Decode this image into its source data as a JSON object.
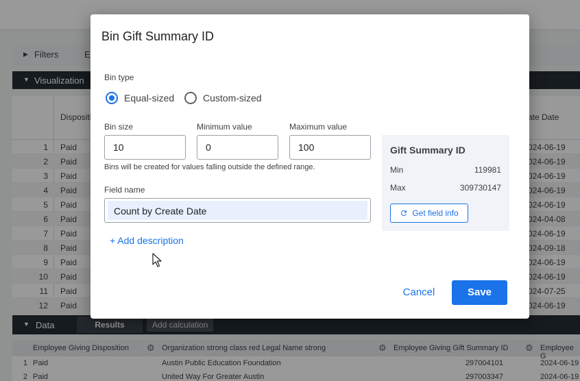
{
  "background": {
    "filters_label": "Filters",
    "filters_extra": "E",
    "visualization_label": "Visualization",
    "viz_header": {
      "disposition": "Dispositi",
      "date": "ate Date"
    },
    "viz_rows": [
      {
        "n": "1",
        "d": "Paid",
        "dt": "024-06-19"
      },
      {
        "n": "2",
        "d": "Paid",
        "dt": "024-06-19"
      },
      {
        "n": "3",
        "d": "Paid",
        "dt": "024-06-19"
      },
      {
        "n": "4",
        "d": "Paid",
        "dt": "024-06-19"
      },
      {
        "n": "5",
        "d": "Paid",
        "dt": "024-06-19"
      },
      {
        "n": "6",
        "d": "Paid",
        "dt": "024-04-08"
      },
      {
        "n": "7",
        "d": "Paid",
        "dt": "024-06-19"
      },
      {
        "n": "8",
        "d": "Paid",
        "dt": "024-09-18"
      },
      {
        "n": "9",
        "d": "Paid",
        "dt": "024-06-19"
      },
      {
        "n": "10",
        "d": "Paid",
        "dt": "024-06-19"
      },
      {
        "n": "11",
        "d": "Paid",
        "dt": "024-07-25"
      },
      {
        "n": "12",
        "d": "Paid",
        "dt": "024-06-19"
      }
    ],
    "data_label": "Data",
    "results_tab": "Results",
    "add_calculation": "Add calculation",
    "data_headers": {
      "col1": "Employee Giving Disposition",
      "col2": "Organization strong class red Legal Name strong",
      "col3": "Employee Giving Gift Summary ID",
      "col4": "Employee G"
    },
    "data_rows": [
      {
        "n": "1",
        "disp": "Paid",
        "org": "Austin Public Education Foundation",
        "id": "297004101",
        "date": "2024-06-19"
      },
      {
        "n": "2",
        "disp": "Paid",
        "org": "United Way For Greater Austin",
        "id": "297003347",
        "date": "2024-06-19"
      }
    ]
  },
  "dialog": {
    "title": "Bin Gift Summary ID",
    "bin_type_label": "Bin type",
    "bin_type_options": [
      {
        "label": "Equal-sized",
        "selected": true
      },
      {
        "label": "Custom-sized",
        "selected": false
      }
    ],
    "bin_size_label": "Bin size",
    "bin_size_value": "10",
    "min_label": "Minimum value",
    "min_value": "0",
    "max_label": "Maximum value",
    "max_value": "100",
    "hint": "Bins will be created for values falling outside the defined range.",
    "field_name_label": "Field name",
    "field_name_value": "Count by Create Date",
    "add_description": "+ Add description",
    "info": {
      "title": "Gift Summary ID",
      "min_label": "Min",
      "min_value": "119981",
      "max_label": "Max",
      "max_value": "309730147",
      "button": "Get field info"
    },
    "cancel": "Cancel",
    "save": "Save",
    "accent_color": "#1a73e8"
  }
}
